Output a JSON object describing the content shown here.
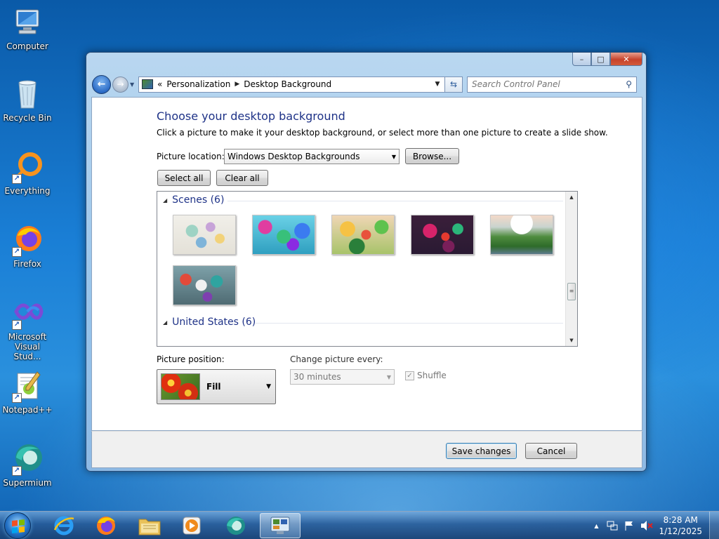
{
  "desktop": {
    "icons": [
      {
        "label": "Computer",
        "icon": "computer-icon"
      },
      {
        "label": "Recycle Bin",
        "icon": "recycle-bin-icon"
      },
      {
        "label": "Everything",
        "icon": "everything-icon"
      },
      {
        "label": "Firefox",
        "icon": "firefox-icon"
      },
      {
        "label": "Microsoft Visual Stud...",
        "label_line1": "Microsoft",
        "label_line2": "Visual Stud...",
        "icon": "visual-studio-icon"
      },
      {
        "label": "Notepad++",
        "icon": "notepadpp-icon"
      },
      {
        "label": "Supermium",
        "icon": "supermium-icon"
      }
    ]
  },
  "window": {
    "controls": {
      "minimize": "–",
      "maximize": "□",
      "close": "✕"
    },
    "breadcrumb": [
      "Personalization",
      "Desktop Background"
    ],
    "breadcrumb_prefix": "«",
    "search_placeholder": "Search Control Panel",
    "heading": "Choose your desktop background",
    "subtext": "Click a picture to make it your desktop background, or select more than one picture to create a slide show.",
    "picture_location_label": "Picture location:",
    "picture_location_value": "Windows Desktop Backgrounds",
    "browse_label": "Browse...",
    "select_all_label": "Select all",
    "clear_all_label": "Clear all",
    "groups": [
      {
        "name": "Scenes (6)",
        "count": 6
      },
      {
        "name": "United States (6)",
        "count": 6
      }
    ],
    "picture_position_label": "Picture position:",
    "picture_position_value": "Fill",
    "change_every_label": "Change picture every:",
    "change_every_value": "30 minutes",
    "shuffle_label": "Shuffle",
    "shuffle_checked": true,
    "save_label": "Save changes",
    "cancel_label": "Cancel"
  },
  "taskbar": {
    "pinned": [
      "internet-explorer-icon",
      "firefox-icon",
      "file-explorer-icon",
      "media-player-icon",
      "supermium-icon",
      "control-panel-icon"
    ],
    "active": "control-panel-icon",
    "time": "8:28 AM",
    "date": "1/12/2025",
    "tray_up_arrow": "▲"
  },
  "colors": {
    "heading_blue": "#1e3287",
    "close_red": "#c7432b"
  }
}
